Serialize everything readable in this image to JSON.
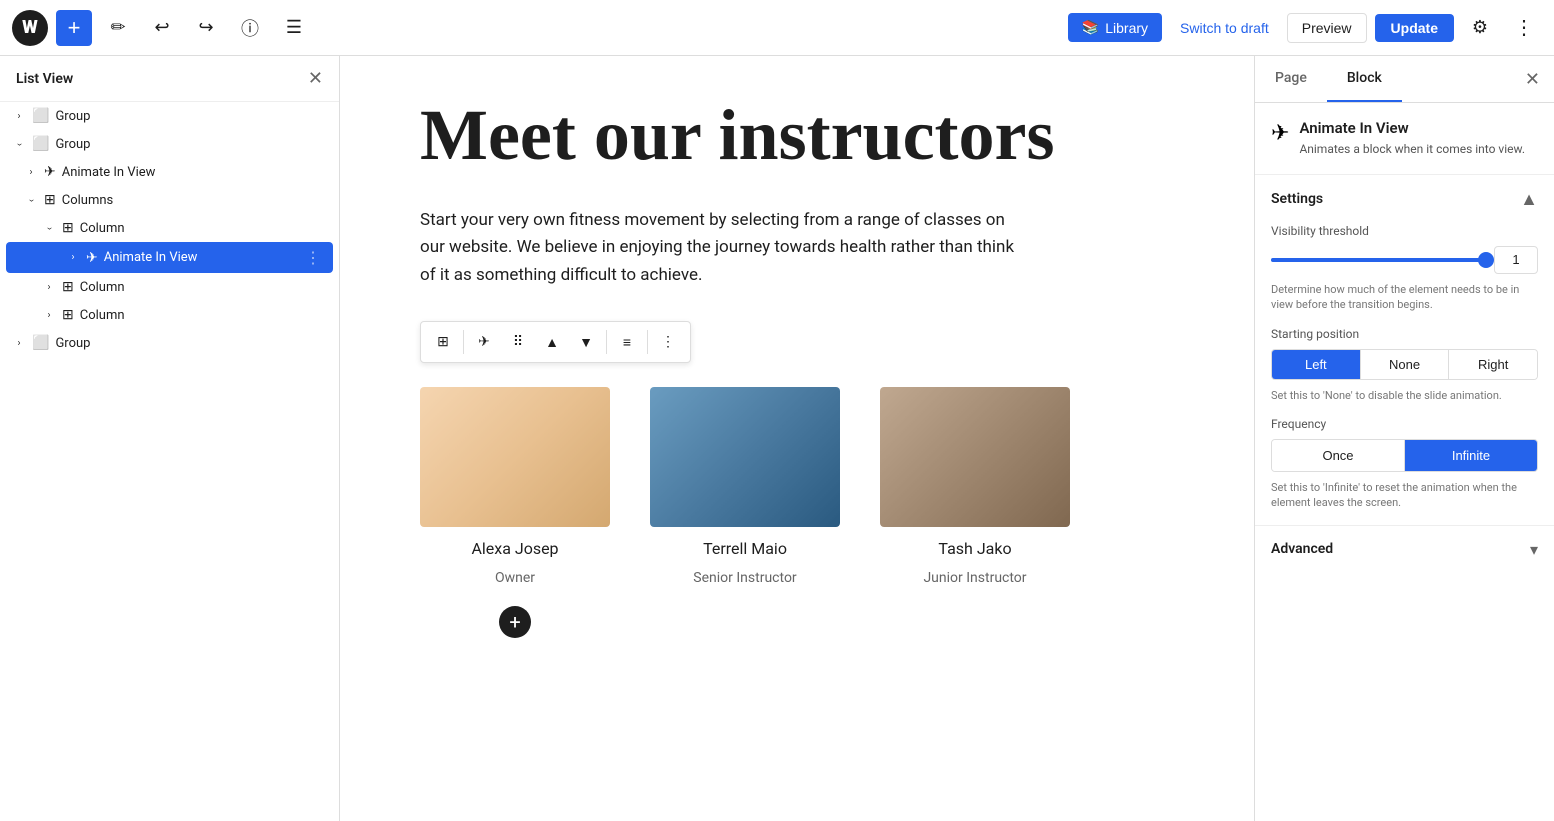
{
  "topbar": {
    "logo_text": "W",
    "add_label": "+",
    "edit_icon": "✏",
    "undo_icon": "↩",
    "redo_icon": "↪",
    "info_icon": "ⓘ",
    "menu_icon": "☰",
    "library_icon": "📚",
    "library_label": "Library",
    "switch_to_draft": "Switch to draft",
    "preview": "Preview",
    "update": "Update",
    "settings_icon": "⚙",
    "more_icon": "⋮"
  },
  "sidebar": {
    "title": "List View",
    "close_icon": "✕",
    "items": [
      {
        "id": "group-1",
        "label": "Group",
        "icon": "⬜",
        "indent": 0,
        "chevron": "›",
        "open": false
      },
      {
        "id": "group-2",
        "label": "Group",
        "icon": "⬜",
        "indent": 0,
        "chevron": "›",
        "open": true
      },
      {
        "id": "animate-1",
        "label": "Animate In View",
        "icon": "✈",
        "indent": 1,
        "chevron": "›",
        "open": false
      },
      {
        "id": "columns-1",
        "label": "Columns",
        "icon": "⊞",
        "indent": 1,
        "chevron": "›",
        "open": true
      },
      {
        "id": "column-1",
        "label": "Column",
        "icon": "⊞",
        "indent": 2,
        "chevron": "›",
        "open": true
      },
      {
        "id": "animate-2",
        "label": "Animate In View",
        "icon": "✈",
        "indent": 3,
        "chevron": "›",
        "open": false,
        "selected": true
      },
      {
        "id": "column-2",
        "label": "Column",
        "icon": "⊞",
        "indent": 2,
        "chevron": "›",
        "open": false
      },
      {
        "id": "column-3",
        "label": "Column",
        "icon": "⊞",
        "indent": 2,
        "chevron": "›",
        "open": false
      },
      {
        "id": "group-3",
        "label": "Group",
        "icon": "⬜",
        "indent": 0,
        "chevron": "›",
        "open": false
      }
    ]
  },
  "editor": {
    "page_title": "Meet our instructors",
    "page_desc": "Start your very own fitness movement by selecting from a range of classes on our website. We believe in enjoying the journey towards health rather than think of it as something difficult to achieve.",
    "instructors": [
      {
        "name": "Alexa Josep",
        "role": "Owner",
        "photo_class": "photo-alexa"
      },
      {
        "name": "Terrell Maio",
        "role": "Senior Instructor",
        "photo_class": "photo-terrell"
      },
      {
        "name": "Tash Jako",
        "role": "Junior Instructor",
        "photo_class": "photo-tash"
      }
    ],
    "add_icon": "+"
  },
  "toolbar": {
    "toggle_icon": "⊞",
    "animate_icon": "✈",
    "drag_icon": "⠿",
    "up_icon": "▲",
    "down_icon": "▼",
    "align_icon": "≡",
    "more_icon": "⋮"
  },
  "rightpanel": {
    "tabs": [
      {
        "id": "page",
        "label": "Page",
        "active": false
      },
      {
        "id": "block",
        "label": "Block",
        "active": true
      }
    ],
    "close_icon": "✕",
    "block_icon": "✈",
    "block_title": "Animate In View",
    "block_desc": "Animates a block when it comes into view.",
    "settings": {
      "title": "Settings",
      "collapse_icon": "▲",
      "visibility_threshold_label": "Visibility threshold",
      "visibility_threshold_value": "1",
      "visibility_desc": "Determine how much of the element needs to be in view before the transition begins.",
      "starting_position_label": "Starting position",
      "starting_position_options": [
        {
          "id": "left",
          "label": "Left",
          "active": true
        },
        {
          "id": "none",
          "label": "None",
          "active": false
        },
        {
          "id": "right",
          "label": "Right",
          "active": false
        }
      ],
      "starting_position_desc": "Set this to 'None' to disable the slide animation.",
      "frequency_label": "Frequency",
      "frequency_options": [
        {
          "id": "once",
          "label": "Once",
          "active": false
        },
        {
          "id": "infinite",
          "label": "Infinite",
          "active": true
        }
      ],
      "frequency_desc": "Set this to 'Infinite' to reset the animation when the element leaves the screen."
    },
    "advanced": {
      "title": "Advanced",
      "chevron": "▾"
    }
  }
}
